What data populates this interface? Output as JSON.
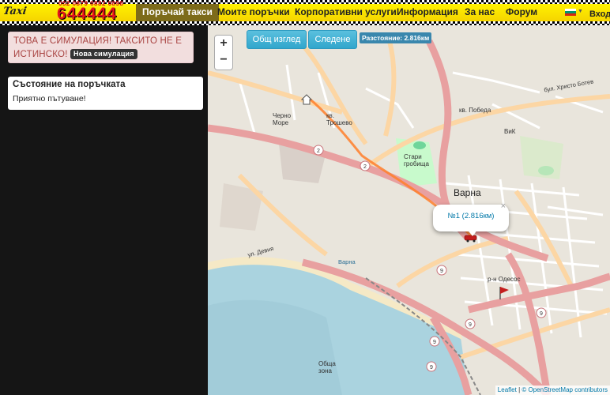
{
  "header": {
    "logo_text": "Taxi",
    "logo_phones": "052 0879 0882 0898",
    "logo_number": "644444",
    "nav": [
      {
        "label": "Поръчай такси",
        "active": true
      },
      {
        "label": "Моите поръчки"
      },
      {
        "label": "Корпоративни услуги"
      },
      {
        "label": "Информация"
      },
      {
        "label": "За нас"
      },
      {
        "label": "Форум"
      }
    ],
    "language_flag": "bulgarian-flag-icon",
    "login_label": "Вход"
  },
  "sidebar": {
    "alert_text": "ТОВА Е СИМУЛАЦИЯ! ТАКСИТО НЕ Е ИСТИНСКО!",
    "new_sim_button": "Нова симулация",
    "status_title": "Състояние на поръчката",
    "status_text": "Приятно пътуване!"
  },
  "map": {
    "zoom_in": "+",
    "zoom_out": "−",
    "overview_button": "Общ изглед",
    "follow_button": "Следене",
    "distance_label": "Разстояние: 2.816км",
    "popup_text": "№1 (2.816км)",
    "popup_close": "×",
    "labels": {
      "varna": "Варна",
      "sv_pobeda": "кв. Победа",
      "vik": "ВиК",
      "stari_grobishta": "Стари гробища",
      "cherno_more": "Черно Море",
      "troshevo": "кв. Трошево",
      "odesos": "р-н Одесос",
      "obshta_zona": "Обща зона",
      "bul_hristo_botev": "бул. Христо Ботев",
      "ul_devnya": "ул. Девня",
      "bul_varna": "Варна"
    },
    "attribution_leaflet": "Leaflet",
    "attribution_osm": "© OpenStreetMap contributors",
    "colors": {
      "land": "#e9e5dc",
      "water": "#aad3df",
      "main_road": "#e8a0a0",
      "secondary_road": "#fcd6a4",
      "park": "#c8facc",
      "route": "#ff7f2a"
    }
  }
}
